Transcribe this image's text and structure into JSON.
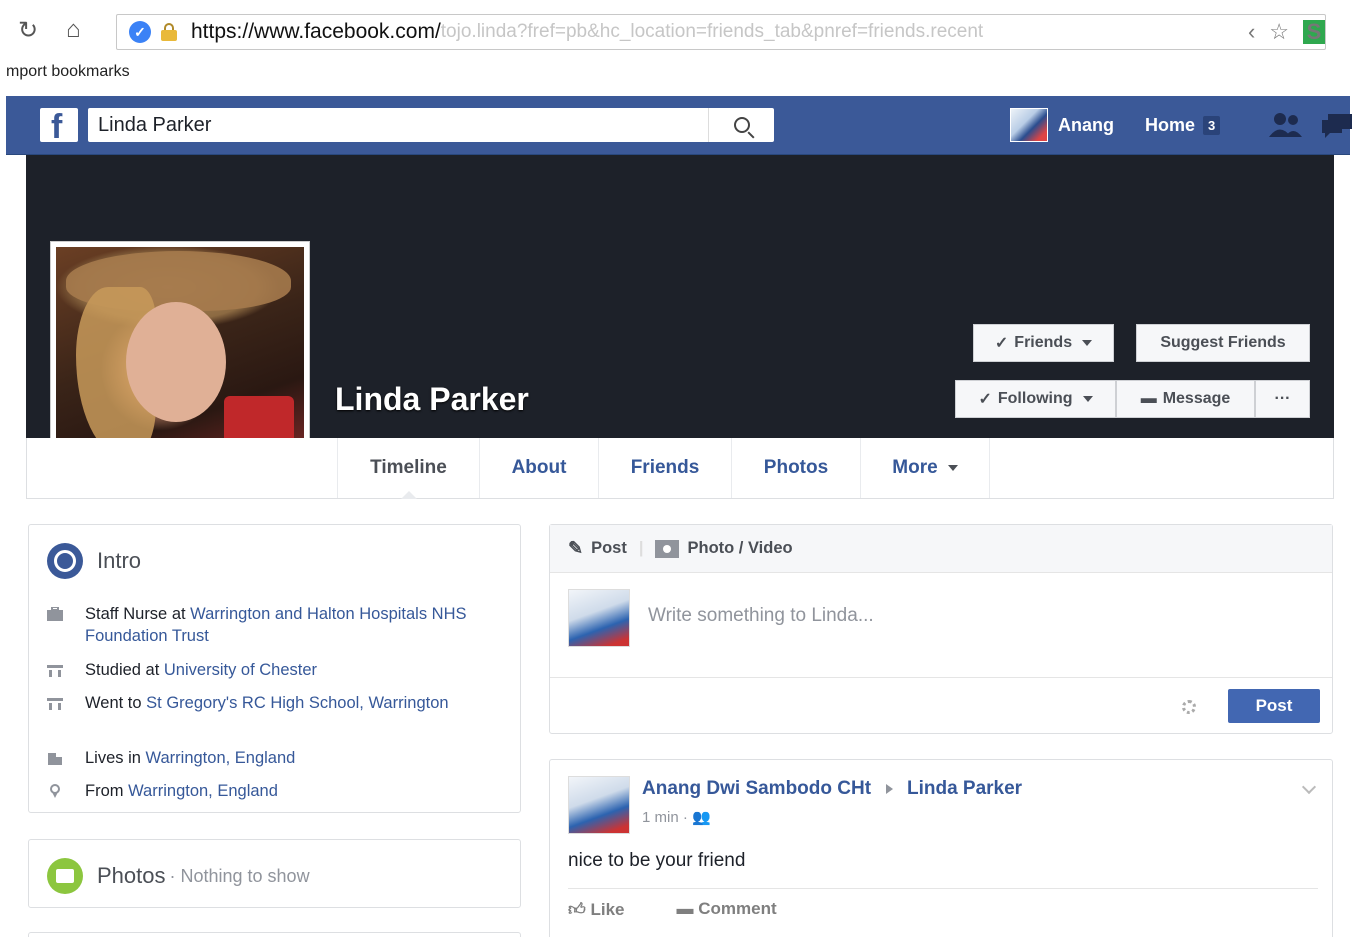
{
  "browser": {
    "url_main": "https://www.facebook.com/",
    "url_rest": "tojo.linda?fref=pb&hc_location=friends_tab&pnref=friends.recent",
    "bookmarks_label": "mport bookmarks",
    "ext_badge": "S"
  },
  "fb": {
    "search_value": "Linda Parker",
    "user_name": "Anang",
    "home_label": "Home",
    "home_count": "3"
  },
  "profile": {
    "name": "Linda Parker",
    "friends_button": "Friends",
    "suggest_button": "Suggest Friends",
    "following_button": "Following",
    "message_button": "Message",
    "more_button": "···"
  },
  "tabs": {
    "timeline": "Timeline",
    "about": "About",
    "friends": "Friends",
    "photos": "Photos",
    "more": "More"
  },
  "intro": {
    "title": "Intro",
    "work_prefix": "Staff Nurse at ",
    "work_link": "Warrington and Halton Hospitals NHS Foundation Trust",
    "studied_prefix": "Studied at ",
    "studied_link": "University of Chester",
    "went_prefix": "Went to ",
    "went_link": "St Gregory's RC High School, Warrington",
    "lives_prefix": "Lives in ",
    "lives_link": "Warrington, England",
    "from_prefix": "From ",
    "from_link": "Warrington, England"
  },
  "photos_card": {
    "title": "Photos",
    "subtitle": "· Nothing to show"
  },
  "composer": {
    "post_tab": "Post",
    "photo_tab": "Photo / Video",
    "placeholder": "Write something to Linda...",
    "post_button": "Post"
  },
  "feed_post": {
    "author": "Anang Dwi Sambodo CHt",
    "target": "Linda Parker",
    "time": "1 min ·",
    "text": "nice to be your friend",
    "like_label": "Like",
    "comment_label": "Comment"
  }
}
